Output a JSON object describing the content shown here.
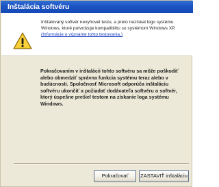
{
  "window": {
    "title": "Inštalácia softvéru"
  },
  "header": {
    "icon": "warning-icon",
    "message": "Inštalovaný softvér nevyhovel testu, a preto nezískal logo systému Windows, ktoré potvrdzuje kompatibilitu so systémom Windows XP.",
    "link_label": "(Informácie o význame tohto testovania.)"
  },
  "body": {
    "warning_text": "Pokračovaním v inštalácii tohto softvéru sa môže poškodiť alebo obmedziť správna funkcia systému teraz alebo v budúcnosti. Spoločnosť Microsoft odporúča inštaláciu softvéru ukončiť a požiadať dodávateľa softvéru o softvér, ktorý úspešne prešiel testom na získanie loga systému Windows."
  },
  "buttons": {
    "continue_label": "Pokračovať",
    "stop_label": "ZASTAVIŤ inštaláciu"
  },
  "colors": {
    "titlebar": "#1d53c2",
    "link": "#1d3fbf",
    "window_bg": "#ece9d8"
  }
}
